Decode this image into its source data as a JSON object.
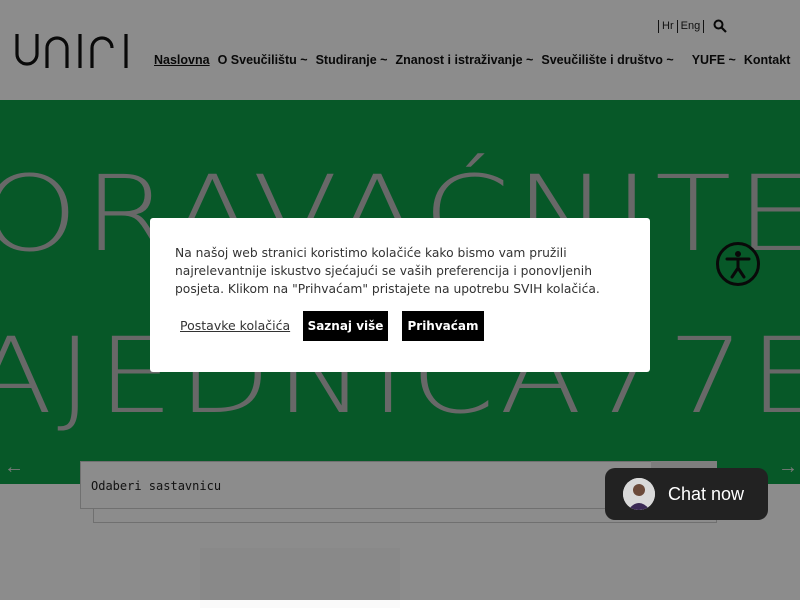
{
  "header": {
    "logo_text": "uniri",
    "languages": [
      "Hr",
      "Eng"
    ],
    "nav": [
      {
        "label": "Naslovna",
        "active": true
      },
      {
        "label": "O Sveučilištu ~"
      },
      {
        "label": "Studiranje ~"
      },
      {
        "label": "Znanost i istraživanje ~"
      },
      {
        "label": "Sveučilište i društvo ~"
      },
      {
        "label": "YUFE ~"
      },
      {
        "label": "Kontakt"
      }
    ]
  },
  "hero": {
    "background": "#0ea04a",
    "line1": "ORAVAĆNITE",
    "line2": "AJEDNICA77E"
  },
  "selector": {
    "label": "Odaberi sastavnicu"
  },
  "cookie_modal": {
    "text": "Na našoj web stranici koristimo kolačiće kako bismo vam pružili najrelevantnije iskustvo sjećajući se vaših preferencija i ponovljenih posjeta. Klikom na \"Prihvaćam\" pristajete na upotrebu SVIH kolačića.",
    "settings_link": "Postavke kolačića",
    "learn_more": "Saznaj više",
    "accept": "Prihvaćam"
  },
  "chat": {
    "label": "Chat now"
  }
}
